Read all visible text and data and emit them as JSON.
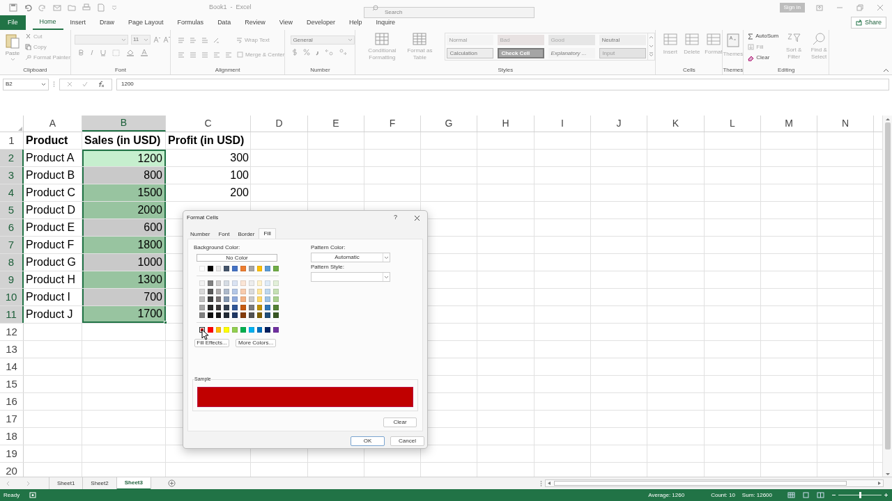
{
  "title_bar": {
    "title": "Book1  -  Excel",
    "search": {
      "placeholder": "Search"
    },
    "sign_in": "Sign in"
  },
  "tabs": [
    {
      "label": "File",
      "kind": "file",
      "selected": false
    },
    {
      "label": "Home",
      "kind": "tab",
      "selected": true
    },
    {
      "label": "Insert",
      "kind": "tab",
      "selected": false
    },
    {
      "label": "Draw",
      "kind": "tab",
      "selected": false
    },
    {
      "label": "Page Layout",
      "kind": "tab",
      "selected": false
    },
    {
      "label": "Formulas",
      "kind": "tab",
      "selected": false
    },
    {
      "label": "Data",
      "kind": "tab",
      "selected": false
    },
    {
      "label": "Review",
      "kind": "tab",
      "selected": false
    },
    {
      "label": "View",
      "kind": "tab",
      "selected": false
    },
    {
      "label": "Developer",
      "kind": "tab",
      "selected": false
    },
    {
      "label": "Help",
      "kind": "tab",
      "selected": false
    },
    {
      "label": "Inquire",
      "kind": "tab",
      "selected": false
    }
  ],
  "share": "Share",
  "ribbon": {
    "clipboard": {
      "label": "Clipboard",
      "paste": "Paste",
      "cut": "Cut",
      "copy": "Copy",
      "format_painter": "Format Painter"
    },
    "font": {
      "label": "Font",
      "size": "11"
    },
    "alignment": {
      "label": "Alignment",
      "wrap_text": "Wrap Text",
      "merge": "Merge & Center"
    },
    "number": {
      "label": "Number",
      "format": "General"
    },
    "styles": {
      "label": "Styles",
      "conditional": "Conditional Formatting",
      "format_table": "Format as Table",
      "cells": [
        {
          "label": "Normal",
          "kind": "normal"
        },
        {
          "label": "Bad",
          "kind": "bad"
        },
        {
          "label": "Good",
          "kind": "good"
        },
        {
          "label": "Neutral",
          "kind": "neutral"
        },
        {
          "label": "Calculation",
          "kind": "calculation"
        },
        {
          "label": "Check Cell",
          "kind": "check"
        },
        {
          "label": "Explanatory ...",
          "kind": "explanatory"
        },
        {
          "label": "Input",
          "kind": "input"
        }
      ]
    },
    "cells": {
      "label": "Cells",
      "buttons": [
        "Insert",
        "Delete",
        "Format"
      ]
    },
    "themes": {
      "label": "Themes",
      "button": "Themes"
    },
    "editing": {
      "label": "Editing",
      "autosum": "AutoSum",
      "fill": "Fill",
      "clear": "Clear",
      "sort": "Sort & Filter",
      "find": "Find & Select"
    }
  },
  "formula_bar": {
    "name_box": "B2",
    "value": "1200"
  },
  "sheet": {
    "columns": [
      {
        "label": "A",
        "selected": false
      },
      {
        "label": "B",
        "selected": true
      },
      {
        "label": "C",
        "selected": false
      },
      {
        "label": "D",
        "selected": false
      },
      {
        "label": "E",
        "selected": false
      },
      {
        "label": "F",
        "selected": false
      },
      {
        "label": "G",
        "selected": false
      },
      {
        "label": "H",
        "selected": false
      },
      {
        "label": "I",
        "selected": false
      },
      {
        "label": "J",
        "selected": false
      },
      {
        "label": "K",
        "selected": false
      },
      {
        "label": "L",
        "selected": false
      },
      {
        "label": "M",
        "selected": false
      },
      {
        "label": "N",
        "selected": false
      }
    ],
    "rows": [
      {
        "header": "1",
        "kind": "header",
        "selected": false,
        "cells": [
          "Product",
          "Sales (in USD)",
          "Profit (in USD)"
        ]
      },
      {
        "header": "2",
        "kind": "data",
        "selected": true,
        "color": "#c6efce",
        "cells": [
          "Product A",
          "1200",
          "300"
        ]
      },
      {
        "header": "3",
        "kind": "data",
        "selected": true,
        "color": "#c9c9c9",
        "cells": [
          "Product B",
          "800",
          "100"
        ]
      },
      {
        "header": "4",
        "kind": "data",
        "selected": true,
        "color": "#98c4a0",
        "cells": [
          "Product C",
          "1500",
          "200"
        ]
      },
      {
        "header": "5",
        "kind": "data",
        "selected": true,
        "color": "#98c4a0",
        "cells": [
          "Product D",
          "2000"
        ]
      },
      {
        "header": "6",
        "kind": "data",
        "selected": true,
        "color": "#c9c9c9",
        "cells": [
          "Product E",
          "600"
        ]
      },
      {
        "header": "7",
        "kind": "data",
        "selected": true,
        "color": "#98c4a0",
        "cells": [
          "Product F",
          "1800"
        ]
      },
      {
        "header": "8",
        "kind": "data",
        "selected": true,
        "color": "#c9c9c9",
        "cells": [
          "Product G",
          "1000"
        ]
      },
      {
        "header": "9",
        "kind": "data",
        "selected": true,
        "color": "#98c4a0",
        "cells": [
          "Product H",
          "1300"
        ]
      },
      {
        "header": "10",
        "kind": "data",
        "selected": true,
        "color": "#c9c9c9",
        "cells": [
          "Product I",
          "700"
        ]
      },
      {
        "header": "11",
        "kind": "data",
        "selected": true,
        "color": "#98c4a0",
        "cells": [
          "Product J",
          "1700"
        ]
      },
      {
        "header": "12",
        "kind": "data",
        "selected": false
      },
      {
        "header": "13",
        "kind": "data",
        "selected": false
      },
      {
        "header": "14",
        "kind": "data",
        "selected": false
      },
      {
        "header": "15",
        "kind": "data",
        "selected": false
      },
      {
        "header": "16",
        "kind": "data",
        "selected": false
      },
      {
        "header": "17",
        "kind": "data",
        "selected": false
      },
      {
        "header": "18",
        "kind": "data",
        "selected": false
      },
      {
        "header": "19",
        "kind": "data",
        "selected": false
      },
      {
        "header": "20",
        "kind": "data",
        "selected": false
      }
    ]
  },
  "dialog": {
    "title": "Format Cells",
    "help": "?",
    "tabs": [
      {
        "label": "Number",
        "selected": false
      },
      {
        "label": "Font",
        "selected": false
      },
      {
        "label": "Border",
        "selected": false
      },
      {
        "label": "Fill",
        "selected": true
      }
    ],
    "background_label": "Background Color:",
    "no_color": "No Color",
    "palette": {
      "theme": [
        {
          "color": "#ffffff",
          "selected": false
        },
        {
          "color": "#000000",
          "selected": false
        },
        {
          "color": "#e7e6e6",
          "selected": false
        },
        {
          "color": "#44546a",
          "selected": false
        },
        {
          "color": "#4472c4",
          "selected": false
        },
        {
          "color": "#ed7d31",
          "selected": false
        },
        {
          "color": "#a5a5a5",
          "selected": false
        },
        {
          "color": "#ffc000",
          "selected": false
        },
        {
          "color": "#5b9bd5",
          "selected": false
        },
        {
          "color": "#70ad47",
          "selected": false
        }
      ],
      "shades": [
        [
          {
            "color": "#f2f2f2",
            "selected": false
          },
          {
            "color": "#808080",
            "selected": false
          },
          {
            "color": "#d0cece",
            "selected": false
          },
          {
            "color": "#d6dce4",
            "selected": false
          },
          {
            "color": "#dae3f3",
            "selected": false
          },
          {
            "color": "#fbe5d6",
            "selected": false
          },
          {
            "color": "#ededed",
            "selected": false
          },
          {
            "color": "#fff2cc",
            "selected": false
          },
          {
            "color": "#deebf7",
            "selected": false
          },
          {
            "color": "#e2f0d9",
            "selected": false
          }
        ],
        [
          {
            "color": "#d9d9d9",
            "selected": false
          },
          {
            "color": "#595959",
            "selected": false
          },
          {
            "color": "#aeabab",
            "selected": false
          },
          {
            "color": "#adb9ca",
            "selected": false
          },
          {
            "color": "#b4c7e7",
            "selected": false
          },
          {
            "color": "#f8cbad",
            "selected": false
          },
          {
            "color": "#dbdbdb",
            "selected": false
          },
          {
            "color": "#ffe699",
            "selected": false
          },
          {
            "color": "#bdd7ee",
            "selected": false
          },
          {
            "color": "#c5e0b4",
            "selected": false
          }
        ],
        [
          {
            "color": "#bfbfbf",
            "selected": false
          },
          {
            "color": "#404040",
            "selected": false
          },
          {
            "color": "#767171",
            "selected": false
          },
          {
            "color": "#8497b0",
            "selected": false
          },
          {
            "color": "#8faadc",
            "selected": false
          },
          {
            "color": "#f4b183",
            "selected": false
          },
          {
            "color": "#c9c9c9",
            "selected": false
          },
          {
            "color": "#ffd966",
            "selected": false
          },
          {
            "color": "#9dc3e6",
            "selected": false
          },
          {
            "color": "#a9d18e",
            "selected": false
          }
        ],
        [
          {
            "color": "#a6a6a6",
            "selected": false
          },
          {
            "color": "#262626",
            "selected": false
          },
          {
            "color": "#3b3838",
            "selected": false
          },
          {
            "color": "#333f50",
            "selected": false
          },
          {
            "color": "#2f5597",
            "selected": false
          },
          {
            "color": "#c55a11",
            "selected": false
          },
          {
            "color": "#7b7b7b",
            "selected": false
          },
          {
            "color": "#bf9000",
            "selected": false
          },
          {
            "color": "#2e75b6",
            "selected": false
          },
          {
            "color": "#548235",
            "selected": false
          }
        ],
        [
          {
            "color": "#808080",
            "selected": false
          },
          {
            "color": "#0d0d0d",
            "selected": false
          },
          {
            "color": "#171717",
            "selected": false
          },
          {
            "color": "#222a35",
            "selected": false
          },
          {
            "color": "#203864",
            "selected": false
          },
          {
            "color": "#843c0c",
            "selected": false
          },
          {
            "color": "#525252",
            "selected": false
          },
          {
            "color": "#7f6000",
            "selected": false
          },
          {
            "color": "#1f4e79",
            "selected": false
          },
          {
            "color": "#385723",
            "selected": false
          }
        ]
      ],
      "standard": [
        {
          "color": "#c00000",
          "selected": true
        },
        {
          "color": "#ff0000",
          "selected": false
        },
        {
          "color": "#ffc000",
          "selected": false
        },
        {
          "color": "#ffff00",
          "selected": false
        },
        {
          "color": "#92d050",
          "selected": false
        },
        {
          "color": "#00b050",
          "selected": false
        },
        {
          "color": "#00b0f0",
          "selected": false
        },
        {
          "color": "#0070c0",
          "selected": false
        },
        {
          "color": "#002060",
          "selected": false
        },
        {
          "color": "#7030a0",
          "selected": false
        }
      ]
    },
    "fill_effects": "Fill Effects...",
    "more_colors": "More Colors...",
    "pattern_color_label": "Pattern Color:",
    "pattern_color": "Automatic",
    "pattern_style_label": "Pattern Style:",
    "sample": {
      "label": "Sample",
      "color": "#c00000"
    },
    "clear": "Clear",
    "ok": "OK",
    "cancel": "Cancel"
  },
  "sheet_tabs": [
    {
      "label": "Sheet1",
      "selected": false
    },
    {
      "label": "Sheet2",
      "selected": false
    },
    {
      "label": "Sheet3",
      "selected": true
    }
  ],
  "status_bar": {
    "mode": "Ready",
    "average": "Average: 1260",
    "count": "Count: 10",
    "sum": "Sum: 12600",
    "zoom": {
      "level": 0.5
    }
  }
}
